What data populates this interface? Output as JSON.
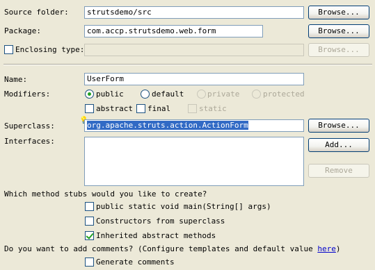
{
  "source_folder": {
    "label": "Source folder:",
    "value": "strutsdemo/src",
    "browse": "Browse..."
  },
  "package": {
    "label": "Package:",
    "value": "com.accp.strutsdemo.web.form",
    "browse": "Browse..."
  },
  "enclosing_type": {
    "label": "Enclosing type:",
    "value": "",
    "browse": "Browse...",
    "checked": false
  },
  "name": {
    "label": "Name:",
    "value": "UserForm"
  },
  "modifiers": {
    "label": "Modifiers:",
    "public": "public",
    "default": "default",
    "private": "private",
    "protected": "protected",
    "abstract": "abstract",
    "final": "final",
    "static": "static",
    "selected": "public"
  },
  "superclass": {
    "label": "Superclass:",
    "value": "org.apache.struts.action.ActionForm",
    "browse": "Browse..."
  },
  "interfaces": {
    "label": "Interfaces:",
    "add": "Add...",
    "remove": "Remove"
  },
  "stubs": {
    "question": "Which method stubs would you like to create?",
    "main": "public static void main(String[] args)",
    "constructors": "Constructors from superclass",
    "inherited": "Inherited abstract methods",
    "main_checked": false,
    "constructors_checked": false,
    "inherited_checked": true
  },
  "comments": {
    "question_prefix": "Do you want to add comments? (Configure templates and default value ",
    "link": "here",
    "question_suffix": ")",
    "generate": "Generate comments",
    "generate_checked": false
  },
  "colors": {
    "background": "#ECE9D8",
    "accent": "#316AC5",
    "check": "#21A121"
  }
}
